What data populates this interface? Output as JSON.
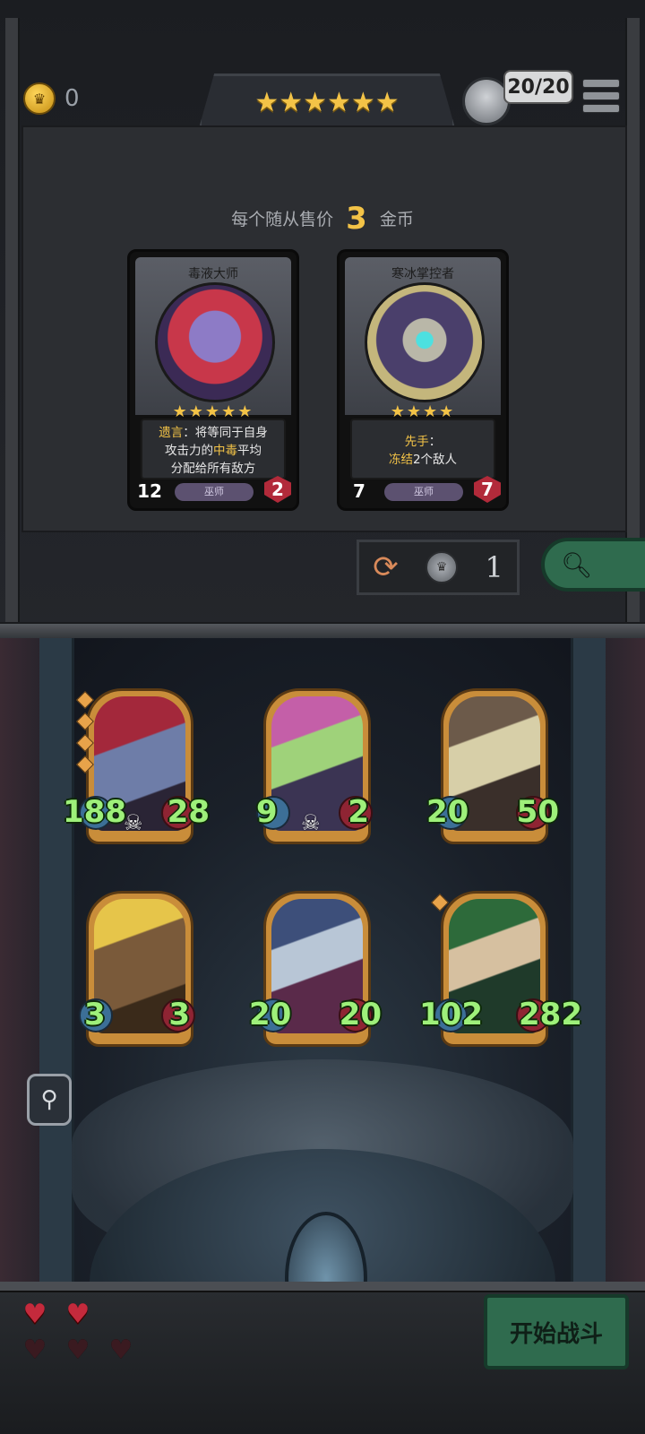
{
  "header": {
    "gold": "0",
    "tier_stars": "★★★★★★",
    "population": "20/20"
  },
  "shop": {
    "price_prefix": "每个随从售价",
    "price_value": "3",
    "price_suffix": "金币",
    "cards": [
      {
        "name": "毒液大师",
        "stars": "★★★★★",
        "desc_keyword": "遗言",
        "desc_line1_rest": "：将等同于自身",
        "desc_line2_pre": "攻击力的",
        "desc_keyword2": "中毒",
        "desc_line2_post": "平均",
        "desc_line3": "分配给所有敌方",
        "attack": "12",
        "health": "2",
        "tribe": "巫师"
      },
      {
        "name": "寒冰掌控者",
        "stars": "★★★★",
        "desc_keyword": "先手",
        "desc_line1_rest": "：",
        "desc_line2_pre": "",
        "desc_keyword2": "冻结",
        "desc_line2_post": "2个敌人",
        "desc_line3": "",
        "attack": "7",
        "health": "7",
        "tribe": "巫师"
      }
    ],
    "reroll_cost": "1"
  },
  "board": {
    "minions": [
      {
        "attack": "188",
        "health": "28",
        "skull": true,
        "gems": 4
      },
      {
        "attack": "9",
        "health": "2",
        "skull": true,
        "gems": 0
      },
      {
        "attack": "20",
        "health": "50",
        "skull": false,
        "gems": 0
      },
      {
        "attack": "3",
        "health": "3",
        "skull": false,
        "gems": 0
      },
      {
        "attack": "20",
        "health": "20",
        "skull": false,
        "gems": 0
      },
      {
        "attack": "102",
        "health": "282",
        "skull": false,
        "gems": 1
      }
    ]
  },
  "footer": {
    "start_label": "开始战斗",
    "lives_full": 2,
    "lives_total": 5
  },
  "icons": {
    "coin": "crown-coin-icon",
    "refresh": "refresh-icon",
    "search": "magnifier-icon",
    "menu": "menu-icon",
    "heart": "heart-icon"
  },
  "colors": {
    "gold": "#f3c347",
    "stat_green": "#9ef07a",
    "button_green": "#2f6b4e",
    "heart_red": "#c42a3c"
  }
}
